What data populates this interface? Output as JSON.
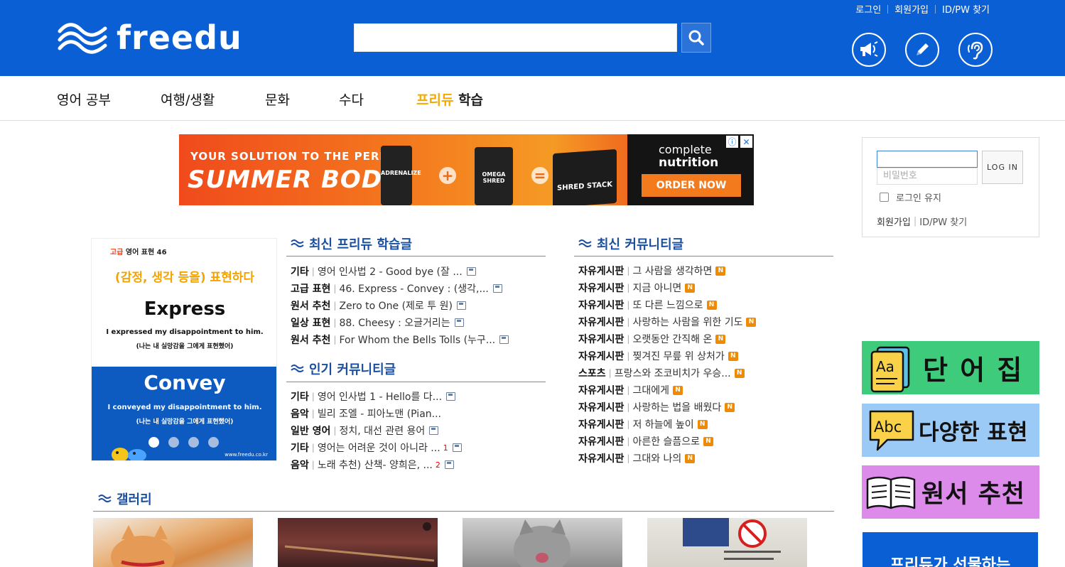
{
  "header": {
    "logo_text": "freedu",
    "search": {
      "value": "",
      "placeholder": ""
    },
    "top_links": [
      "로그인",
      "회원가입",
      "ID/PW 찾기"
    ],
    "icon_buttons": [
      "megaphone-icon",
      "pencil-icon",
      "ear-icon"
    ],
    "brand_color": "#0a5fd4"
  },
  "nav": {
    "items": [
      "영어 공부",
      "여행/생활",
      "문화",
      "수다"
    ],
    "special": {
      "part1": "프리듀",
      "part2": " 학습"
    }
  },
  "ad": {
    "line1": "YOUR SOLUTION TO THE PERFECT",
    "line2": "SUMMER BODY",
    "products": [
      "ADRENALIZE",
      "OMEGA SHRED",
      "SHRED STACK"
    ],
    "brand1": "complete",
    "brand2": "nutrition",
    "cta": "ORDER NOW"
  },
  "slide": {
    "tag_level": "고급",
    "tag_rest": " 영어 표현 46",
    "heading": "(감정, 생각 등을) 표현하다",
    "word1": "Express",
    "example1": "I expressed my disappointment to him.",
    "example1_ko": "(나는 내 실망감을 그에게 표현했어)",
    "word2": "Convey",
    "example2": "I conveyed my disappointment to him.",
    "example2_ko": "(나는 내 실망감을 그에게 표현했어)",
    "footer": "www.freedu.co.kr",
    "dots_total": 4,
    "dot_active": 1
  },
  "latest_learning": {
    "title": "최신 프리듀 학습글",
    "rows": [
      {
        "category": "기타",
        "title": "영어 인사법 2 - Good bye (잘 ..."
      },
      {
        "category": "고급 표현",
        "title": "46. Express - Convey : (생각,..."
      },
      {
        "category": "원서 추천",
        "title": "Zero to One (제로 투 원)"
      },
      {
        "category": "일상 표현",
        "title": "88. Cheesy : 오글거리는"
      },
      {
        "category": "원서 추천",
        "title": "For Whom the Bells Tolls (누구..."
      }
    ]
  },
  "popular_community": {
    "title": "인기 커뮤니티글",
    "rows": [
      {
        "category": "기타",
        "title": "영어 인사법 1 - Hello를 다...",
        "count": "",
        "doc": true
      },
      {
        "category": "음악",
        "title": "빌리 조엘 - 피아노맨 (Pian...",
        "count": "",
        "doc": false
      },
      {
        "category": "일반 영어",
        "title": "정치, 대선 관련 용어",
        "count": "",
        "doc": true
      },
      {
        "category": "기타",
        "title": "영어는 어려운 것이 아니라 ...",
        "count": "1",
        "doc": true
      },
      {
        "category": "음악",
        "title": "노래 추천) 산책- 양희은, ...",
        "count": "2",
        "doc": true
      }
    ]
  },
  "latest_community": {
    "title": "최신 커뮤니티글",
    "badge": "N",
    "rows": [
      {
        "category": "자유게시판",
        "title": "그 사람을 생각하면"
      },
      {
        "category": "자유게시판",
        "title": "지금 아니면"
      },
      {
        "category": "자유게시판",
        "title": "또 다른 느낌으로"
      },
      {
        "category": "자유게시판",
        "title": "사랑하는 사람을 위한 기도"
      },
      {
        "category": "자유게시판",
        "title": "오랫동안 간직해 온"
      },
      {
        "category": "자유게시판",
        "title": "찢겨진 무릎 위 상처가"
      },
      {
        "category": "스포츠",
        "title": "프랑스와 조코비치가 우승..."
      },
      {
        "category": "자유게시판",
        "title": "그대에게"
      },
      {
        "category": "자유게시판",
        "title": "사랑하는 법을 배웠다"
      },
      {
        "category": "자유게시판",
        "title": "저 하늘에 높이"
      },
      {
        "category": "자유게시판",
        "title": "아른한 슬픔으로"
      },
      {
        "category": "자유게시판",
        "title": "그대와 나의"
      }
    ]
  },
  "login": {
    "id_value": "",
    "pw_placeholder": "비밀번호",
    "button": "LOG IN",
    "keep": "로그인 유지",
    "join": "회원가입",
    "find": "ID/PW 찾기"
  },
  "side_banners": [
    {
      "text": "단 어 집",
      "color": "#3ecb7b",
      "icon": "vocabulary-icon"
    },
    {
      "text": "다양한 표현",
      "color": "#9ccaf7",
      "icon": "speech-bubble-icon"
    },
    {
      "text": "원서 추천",
      "color": "#dd8bea",
      "icon": "open-book-icon"
    }
  ],
  "gift_banner": "프리듀가 선물하는",
  "gallery": {
    "title": "갤러리",
    "thumbs": [
      "cat-photo",
      "bag-photo",
      "cat-photo",
      "poster-photo"
    ]
  }
}
